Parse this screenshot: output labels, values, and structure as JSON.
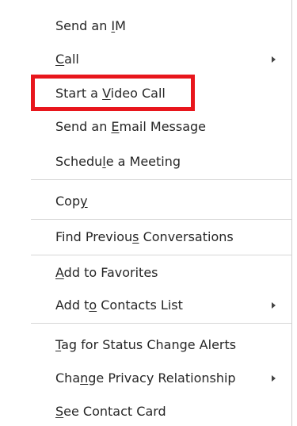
{
  "menu": {
    "items": [
      {
        "before": "Send an ",
        "mnemonic": "I",
        "after": "M",
        "submenu": false
      },
      {
        "before": "",
        "mnemonic": "C",
        "after": "all",
        "submenu": true
      },
      {
        "before": "Start a ",
        "mnemonic": "V",
        "after": "ideo Call",
        "submenu": false
      },
      {
        "before": "Send an ",
        "mnemonic": "E",
        "after": "mail Message",
        "submenu": false
      },
      {
        "before": "Schedu",
        "mnemonic": "l",
        "after": "e a Meeting",
        "submenu": false
      },
      {
        "before": "Cop",
        "mnemonic": "y",
        "after": "",
        "submenu": false
      },
      {
        "before": "Find Previou",
        "mnemonic": "s",
        "after": " Conversations",
        "submenu": false
      },
      {
        "before": "",
        "mnemonic": "A",
        "after": "dd to Favorites",
        "submenu": false
      },
      {
        "before": "Add t",
        "mnemonic": "o",
        "after": " Contacts List",
        "submenu": true
      },
      {
        "before": "",
        "mnemonic": "T",
        "after": "ag for Status Change Alerts",
        "submenu": false
      },
      {
        "before": "Cha",
        "mnemonic": "n",
        "after": "ge Privacy Relationship",
        "submenu": true
      },
      {
        "before": "",
        "mnemonic": "S",
        "after": "ee Contact Card",
        "submenu": false
      }
    ]
  },
  "highlight": {
    "item_index": 2,
    "color": "#e8161c"
  }
}
